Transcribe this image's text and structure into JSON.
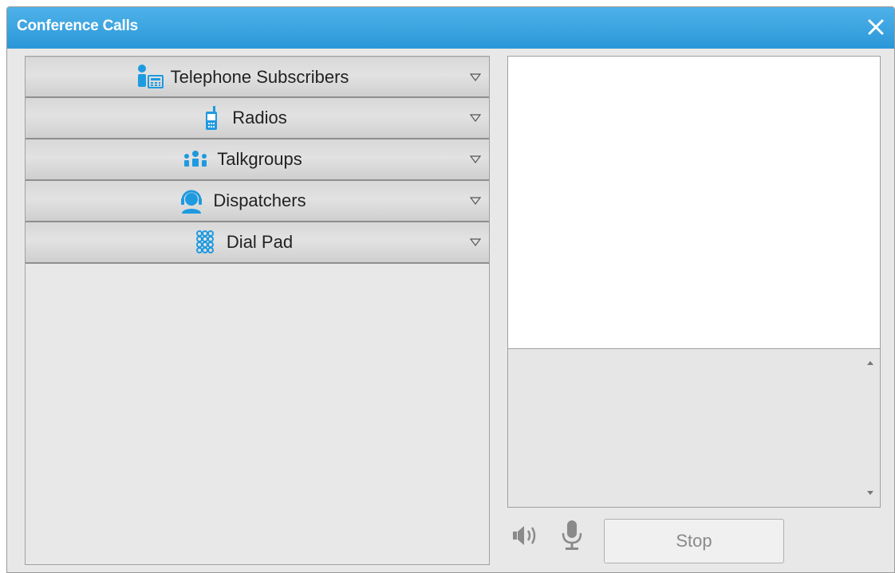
{
  "window": {
    "title": "Conference Calls",
    "accent_color": "#2a97d8"
  },
  "sections": [
    {
      "label": "Telephone Subscribers",
      "icon": "telephone-subscriber-icon"
    },
    {
      "label": "Radios",
      "icon": "radio-icon"
    },
    {
      "label": "Talkgroups",
      "icon": "talkgroup-icon"
    },
    {
      "label": "Dispatchers",
      "icon": "dispatcher-icon"
    },
    {
      "label": "Dial Pad",
      "icon": "dial-pad-icon"
    }
  ],
  "controls": {
    "speaker_icon": "speaker-icon",
    "mic_icon": "microphone-icon",
    "stop_label": "Stop"
  }
}
